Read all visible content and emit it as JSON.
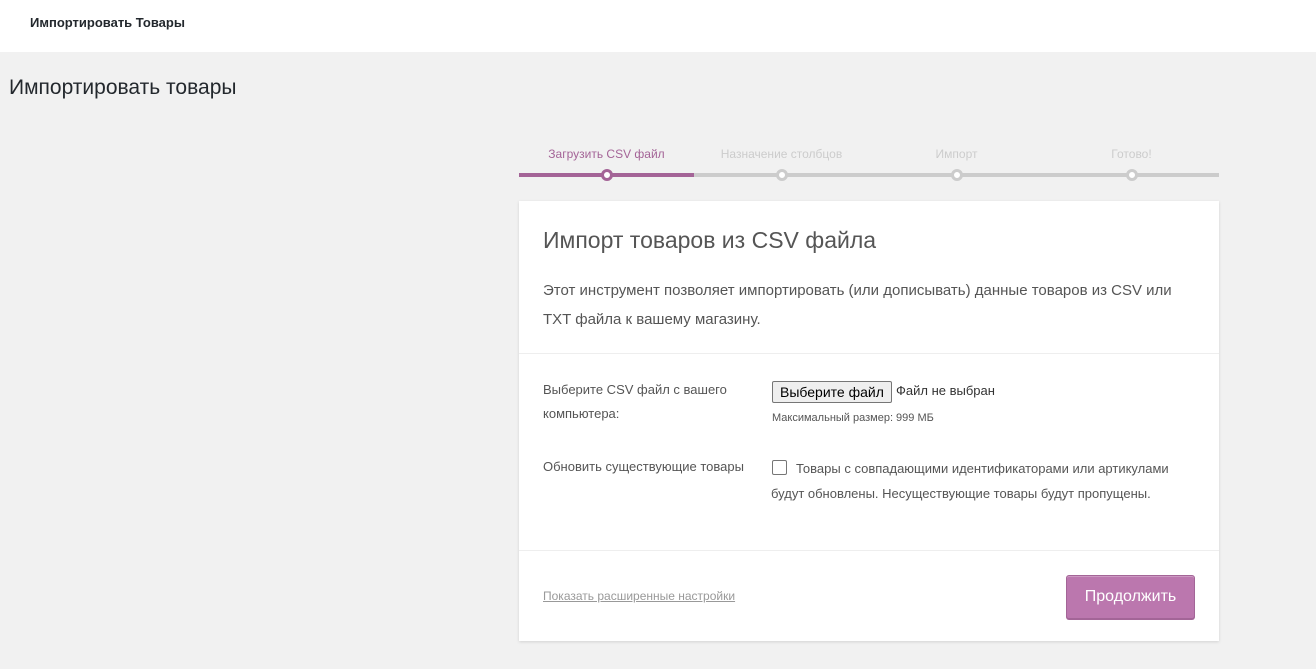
{
  "topbar": {
    "title": "Импортировать Товары"
  },
  "page": {
    "title": "Импортировать товары"
  },
  "steps": [
    {
      "label": "Загрузить CSV файл",
      "active": true
    },
    {
      "label": "Назначение столбцов",
      "active": false
    },
    {
      "label": "Импорт",
      "active": false
    },
    {
      "label": "Готово!",
      "active": false
    }
  ],
  "card": {
    "title": "Импорт товаров из CSV файла",
    "description": "Этот инструмент позволяет импортировать (или дописывать) данные товаров из CSV или TXT файла к вашему магазину.",
    "file_row": {
      "label": "Выберите CSV файл с вашего компьютера:",
      "button_label": "Выберите файл",
      "status": "Файл не выбран",
      "hint": "Максимальный размер: 999 МБ"
    },
    "update_row": {
      "label": "Обновить существующие товары",
      "checkbox_text": "Товары с совпадающими идентификаторами или артикулами будут обновлены. Несуществующие товары будут пропущены.",
      "checked": false
    },
    "footer": {
      "advanced_link": "Показать расширенные настройки",
      "continue_label": "Продолжить"
    }
  },
  "colors": {
    "accent": "#a46497",
    "button": "#bb77ae",
    "inactive": "#cccccc",
    "background": "#f1f1f1"
  }
}
